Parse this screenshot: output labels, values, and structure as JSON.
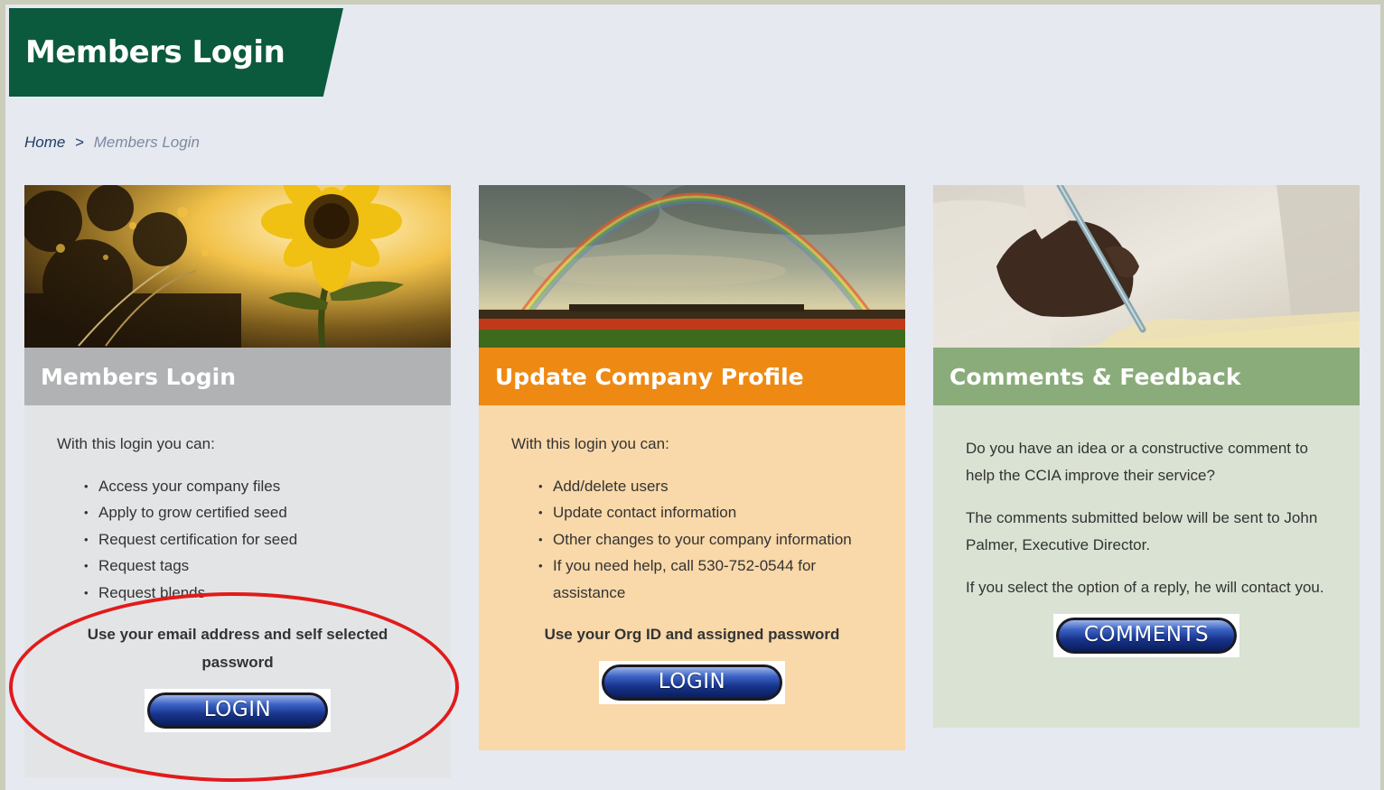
{
  "page": {
    "title": "Members Login"
  },
  "breadcrumb": {
    "home": "Home",
    "separator": ">",
    "current": "Members Login"
  },
  "cards": [
    {
      "title": "Members Login",
      "intro": "With this login you can:",
      "items": [
        "Access your company files",
        "Apply to grow certified seed",
        "Request certification for seed",
        "Request tags",
        "Request blends"
      ],
      "note": "Use your email address and self selected password",
      "button": "LOGIN"
    },
    {
      "title": "Update Company Profile",
      "intro": "With this login you can:",
      "items": [
        "Add/delete users",
        "Update contact information",
        "Other changes to your company information",
        "If you need help, call 530-752-0544 for assistance"
      ],
      "note": "Use your Org ID and assigned password",
      "button": "LOGIN"
    },
    {
      "title": "Comments & Feedback",
      "paragraphs": [
        "Do you have an idea or a constructive comment to help the CCIA improve their service?",
        "The comments submitted below will be sent to John Palmer, Executive Director.",
        "If you select the option of a reply, he will contact you."
      ],
      "button": "COMMENTS"
    }
  ],
  "colors": {
    "banner": "#0c5a3d",
    "card1_header": "#b1b2b4",
    "card2_header": "#ee8a13",
    "card3_header": "#8aac7a",
    "highlight": "#e11b1b"
  }
}
